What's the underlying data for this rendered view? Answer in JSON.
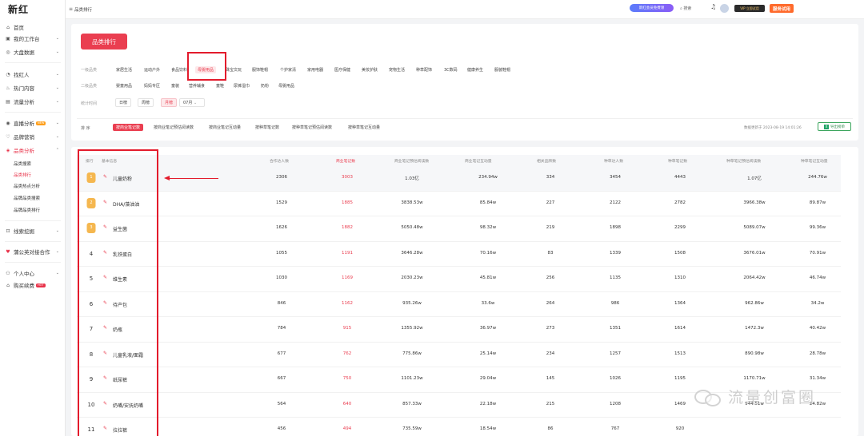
{
  "app": {
    "logo": "新红"
  },
  "sidebar": {
    "items": [
      {
        "label": "首页",
        "icon": "home-icon"
      },
      {
        "label": "我的工作台",
        "icon": "workbench-icon"
      },
      {
        "label": "大盘数据",
        "icon": "dashboard-icon"
      },
      {
        "label": "找红人",
        "icon": "search-person-icon"
      },
      {
        "label": "热门内容",
        "icon": "fire-icon"
      },
      {
        "label": "流量分析",
        "icon": "chart-icon"
      },
      {
        "label": "直播分析",
        "icon": "live-icon",
        "tag": "NEW"
      },
      {
        "label": "品牌营销",
        "icon": "brand-icon"
      },
      {
        "label": "品类分析",
        "icon": "category-icon"
      },
      {
        "label": "线索挖掘",
        "icon": "clue-icon"
      },
      {
        "label": "蒲公英对接合作",
        "icon": "cooperate-icon"
      },
      {
        "label": "个人中心",
        "icon": "user-icon"
      },
      {
        "label": "购买续费",
        "icon": "cart-icon",
        "tag": "HOT"
      }
    ],
    "sub_items": [
      "品类搜索",
      "品类排行",
      "品类热点分析",
      "品牌品类搜索",
      "品牌品类排行"
    ]
  },
  "topbar": {
    "breadcrumb": "品类排行",
    "promo": "新红会员免费领",
    "search": "搜索",
    "vip": "VIP 立即试用",
    "trial": "服务试用"
  },
  "filters": {
    "page_title": "品类排行",
    "row1_label": "一级品类",
    "row1_options": [
      "家居生活",
      "运动户外",
      "食品饮料",
      "母婴用品",
      "珠宝文玩",
      "服饰鞋帽",
      "个护家清",
      "家用电器",
      "医疗保健",
      "美妆护肤",
      "宠物生活",
      "种草配饰",
      "3C数码",
      "健康养生",
      "服装鞋帽"
    ],
    "row1_selected": "母婴用品",
    "row2_label": "二级品类",
    "row2_options": [
      "婴童用品",
      "妈妈专区",
      "童装",
      "营养辅食",
      "童鞋",
      "尿裤湿巾",
      "奶粉",
      "母婴用品"
    ],
    "row3_label": "统计时间",
    "time_options": [
      "日榜",
      "周榜",
      "月榜"
    ],
    "time_selected": "月榜",
    "month": "07月"
  },
  "sort": {
    "label": "排 序",
    "options": [
      "按商业笔记数",
      "按商业笔记预估阅读数",
      "按商业笔记互动量",
      "按种草笔记数",
      "按种草笔记预估阅读数",
      "按种草笔记互动量"
    ],
    "selected": "按商业笔记数",
    "update_time": "数据更新于 2023-08-19 14:01:26",
    "export": "导出榜单"
  },
  "table": {
    "headers": [
      "排行",
      "基本信息",
      "合作达人数",
      "商业笔记数",
      "商业笔记预估阅读数",
      "商业笔记互动量",
      "相关品牌数",
      "种草达人数",
      "种草笔记数",
      "种草笔记预估阅读数",
      "种草笔记互动量"
    ],
    "rows": [
      {
        "rank": "1",
        "name": "儿童奶粉",
        "c1": "2306",
        "c2": "3003",
        "c3": "1.03亿",
        "c4": "234.94w",
        "c5": "334",
        "c6": "3454",
        "c7": "4443",
        "c8": "1.07亿",
        "c9": "244.76w"
      },
      {
        "rank": "2",
        "name": "DHA/藻油油",
        "c1": "1529",
        "c2": "1885",
        "c3": "3838.53w",
        "c4": "85.84w",
        "c5": "227",
        "c6": "2122",
        "c7": "2782",
        "c8": "3966.38w",
        "c9": "89.87w"
      },
      {
        "rank": "3",
        "name": "益生菌",
        "c1": "1626",
        "c2": "1882",
        "c3": "5050.48w",
        "c4": "98.32w",
        "c5": "219",
        "c6": "1898",
        "c7": "2299",
        "c8": "5089.07w",
        "c9": "99.36w"
      },
      {
        "rank": "4",
        "name": "乳铁蛋白",
        "c1": "1055",
        "c2": "1191",
        "c3": "3646.28w",
        "c4": "70.16w",
        "c5": "83",
        "c6": "1339",
        "c7": "1508",
        "c8": "3676.01w",
        "c9": "70.91w"
      },
      {
        "rank": "5",
        "name": "维生素",
        "c1": "1030",
        "c2": "1169",
        "c3": "2030.23w",
        "c4": "45.81w",
        "c5": "256",
        "c6": "1135",
        "c7": "1310",
        "c8": "2064.42w",
        "c9": "46.74w"
      },
      {
        "rank": "6",
        "name": "待产包",
        "c1": "846",
        "c2": "1162",
        "c3": "935.26w",
        "c4": "33.6w",
        "c5": "264",
        "c6": "986",
        "c7": "1364",
        "c8": "962.86w",
        "c9": "34.2w"
      },
      {
        "rank": "7",
        "name": "奶瓶",
        "c1": "784",
        "c2": "915",
        "c3": "1355.92w",
        "c4": "36.97w",
        "c5": "273",
        "c6": "1351",
        "c7": "1614",
        "c8": "1472.3w",
        "c9": "40.42w"
      },
      {
        "rank": "8",
        "name": "儿童乳液/面霜",
        "c1": "677",
        "c2": "762",
        "c3": "775.86w",
        "c4": "25.14w",
        "c5": "234",
        "c6": "1257",
        "c7": "1513",
        "c8": "890.98w",
        "c9": "28.78w"
      },
      {
        "rank": "9",
        "name": "纸尿裤",
        "c1": "667",
        "c2": "750",
        "c3": "1101.23w",
        "c4": "29.04w",
        "c5": "145",
        "c6": "1026",
        "c7": "1195",
        "c8": "1170.71w",
        "c9": "31.34w"
      },
      {
        "rank": "10",
        "name": "奶嘴/安抚奶嘴",
        "c1": "564",
        "c2": "640",
        "c3": "857.33w",
        "c4": "22.18w",
        "c5": "215",
        "c6": "1208",
        "c7": "1469",
        "c8": "944.51w",
        "c9": "24.82w"
      },
      {
        "rank": "11",
        "name": "拉拉裤",
        "c1": "456",
        "c2": "494",
        "c3": "735.59w",
        "c4": "18.54w",
        "c5": "86",
        "c6": "767",
        "c7": "920",
        "c8": "",
        "c9": ""
      },
      {
        "rank": "12",
        "name": "吸管",
        "c1": "457",
        "c2": "490",
        "c3": "529.87w",
        "c4": "14.34w",
        "c5": "184",
        "c6": "1094",
        "c7": "1329",
        "c8": "677.09w",
        "c9": "18.82w"
      },
      {
        "rank": "13",
        "name": "水杯",
        "c1": "444",
        "c2": "465",
        "c3": "502.11w",
        "c4": "13.02w",
        "c5": "243",
        "c6": "877",
        "c7": "982",
        "c8": "599.14w",
        "c9": "15.85w"
      }
    ]
  },
  "watermark": "流量创富圈",
  "colors": {
    "accent": "#ea3e50",
    "highlight": "#e31b2c",
    "medal": "#f5b74f"
  }
}
